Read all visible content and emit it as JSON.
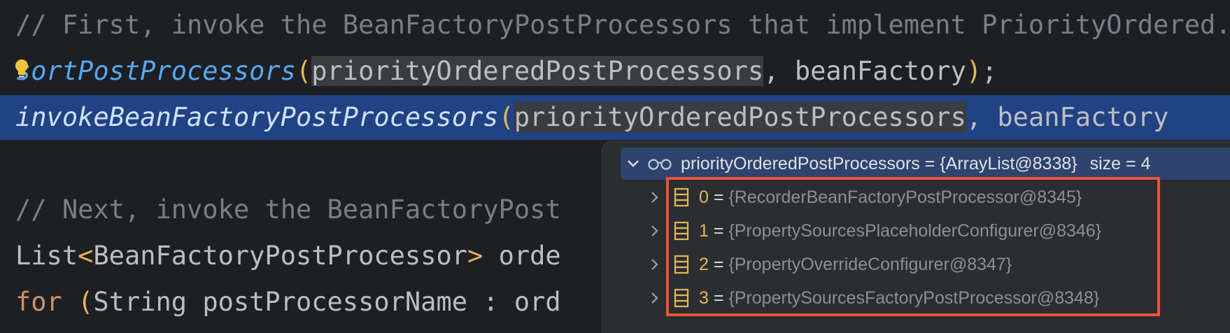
{
  "editor": {
    "line1": {
      "comment": "// First, invoke the BeanFactoryPostProcessors that implement PriorityOrdered."
    },
    "line2": {
      "method": "sortPostProcessors",
      "open": "(",
      "arg1": "priorityOrderedPostProcessors",
      "rest": ", beanFactory",
      "close": ")",
      "semi": ";"
    },
    "line3": {
      "method": "invokeBeanFactoryPostProcessors",
      "open": "(",
      "arg1": "priorityOrderedPostProcessors",
      "rest": ", beanFactory"
    },
    "line5": {
      "comment": "// Next, invoke the BeanFactoryPost"
    },
    "line6": {
      "type": "List",
      "lt": "<",
      "generic": "BeanFactoryPostProcessor",
      "gt": ">",
      "rest": " orde"
    },
    "line7": {
      "kw": "for",
      "sp": " ",
      "open": "(",
      "rest": "String postProcessorName : ord"
    }
  },
  "debug_popup": {
    "header": {
      "name": "priorityOrderedPostProcessors",
      "eq": " = ",
      "value": "{ArrayList@8338}",
      "size": "size = 4"
    },
    "items": [
      {
        "index": "0",
        "eq": " = ",
        "value": "{RecorderBeanFactoryPostProcessor@8345}"
      },
      {
        "index": "1",
        "eq": " = ",
        "value": "{PropertySourcesPlaceholderConfigurer@8346}"
      },
      {
        "index": "2",
        "eq": " = ",
        "value": "{PropertyOverrideConfigurer@8347}"
      },
      {
        "index": "3",
        "eq": " = ",
        "value": "{PropertySourcesFactoryPostProcessor@8348}"
      }
    ]
  },
  "colors": {
    "background": "#1e1f22",
    "selection": "#214283",
    "highlight_box": "#e8553a",
    "keyword": "#cf8e6d",
    "bracket": "#e2b85a"
  },
  "icons": [
    "lightbulb-icon",
    "chevron-down-icon",
    "watch-glasses-icon",
    "chevron-right-icon",
    "array-icon"
  ]
}
